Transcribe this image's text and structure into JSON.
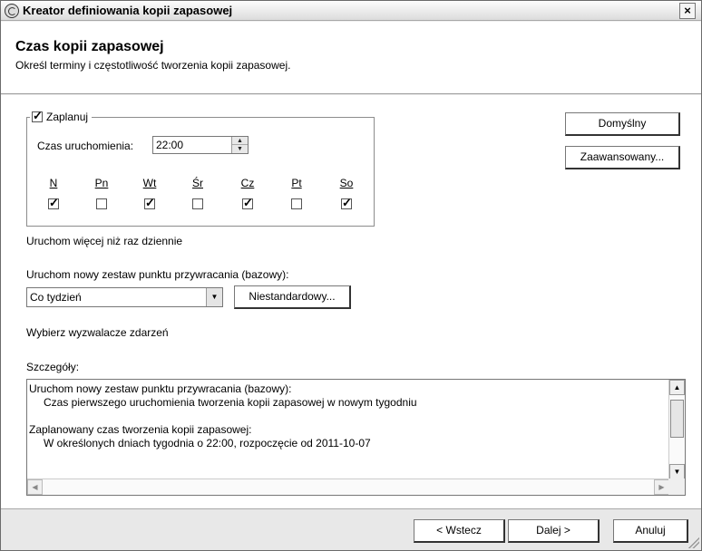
{
  "window": {
    "title": "Kreator definiowania kopii zapasowej",
    "close_label": "×"
  },
  "header": {
    "title": "Czas kopii zapasowej",
    "subtitle": "Określ terminy i częstotliwość tworzenia kopii zapasowej."
  },
  "schedule": {
    "enabled": true,
    "label": "Zaplanuj",
    "start_time_label": "Czas uruchomienia:",
    "start_time_value": "22:00",
    "days": [
      {
        "label": "N",
        "checked": true
      },
      {
        "label": "Pn",
        "checked": false
      },
      {
        "label": "Wt",
        "checked": true
      },
      {
        "label": "Śr",
        "checked": false
      },
      {
        "label": "Cz",
        "checked": true
      },
      {
        "label": "Pt",
        "checked": false
      },
      {
        "label": "So",
        "checked": true
      }
    ]
  },
  "side_buttons": {
    "default_label": "Domyślny",
    "advanced_label": "Zaawansowany..."
  },
  "run_multiple_label": "Uruchom więcej niż raz dziennie",
  "restore_point": {
    "label": "Uruchom nowy zestaw punktu przywracania (bazowy):",
    "selected_value": "Co tydzień",
    "custom_button_label": "Niestandardowy..."
  },
  "triggers_label": "Wybierz wyzwalacze zdarzeń",
  "details": {
    "label": "Szczegóły:",
    "lines": [
      "Uruchom nowy zestaw punktu przywracania (bazowy):",
      "Czas pierwszego uruchomienia tworzenia kopii zapasowej w nowym tygodniu",
      "Zaplanowany czas tworzenia kopii zapasowej:",
      "W określonych dniach tygodnia o 22:00, rozpoczęcie od 2011-10-07"
    ]
  },
  "footer": {
    "back_label": "< Wstecz",
    "next_label": "Dalej >",
    "cancel_label": "Anuluj"
  }
}
